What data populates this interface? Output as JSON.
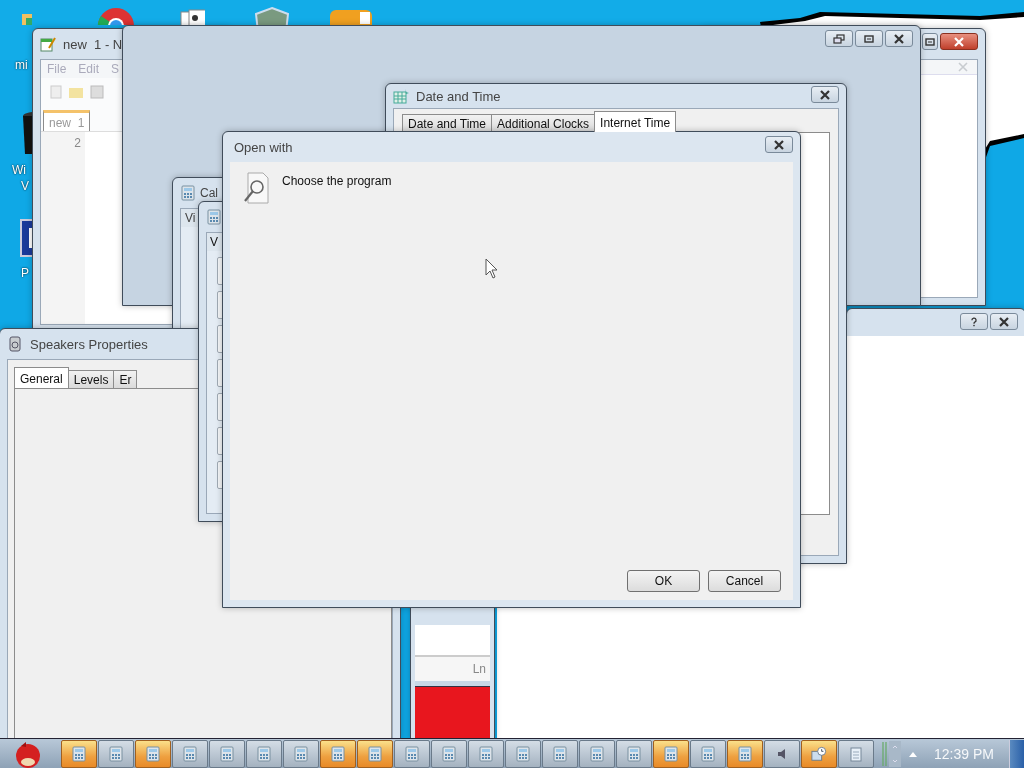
{
  "desktop_icons": [
    {
      "kind": "photo-app",
      "label_lines": [
        "mi"
      ]
    },
    {
      "kind": "round-app"
    },
    {
      "kind": "cards"
    },
    {
      "kind": "shield"
    },
    {
      "kind": "game"
    },
    {
      "kind": "trash",
      "label_lines": [
        "Wi",
        "V"
      ]
    },
    {
      "kind": "blue-square",
      "label_lines": [
        "P"
      ]
    }
  ],
  "notepad": {
    "title": "new  1 - N",
    "menu": [
      "File",
      "Edit",
      "S"
    ],
    "tabs": [
      {
        "label": "new  1",
        "selected": true
      }
    ],
    "line_numbers": [
      "2"
    ]
  },
  "date_and_time": {
    "title": "Date and Time",
    "tabs": [
      {
        "label": "Date and Time",
        "selected": false
      },
      {
        "label": "Additional Clocks",
        "selected": false
      },
      {
        "label": "Internet Time",
        "selected": true
      }
    ]
  },
  "calculators": [
    {
      "title": "Cal",
      "menu": [
        "Vi"
      ]
    },
    {
      "menu": [
        "V"
      ]
    }
  ],
  "speakers_properties": {
    "title": "Speakers Properties",
    "tabs": [
      {
        "label": "General",
        "selected": true
      },
      {
        "label": "Levels",
        "selected": false
      },
      {
        "label": "Er",
        "selected": false
      }
    ]
  },
  "status_strip": {
    "status": "Ln"
  },
  "open_with": {
    "title": "Open with",
    "heading": "Choose the program",
    "buttons": [
      "OK",
      "Cancel"
    ]
  },
  "taskbar": {
    "tasks": [
      {
        "kind": "calculator",
        "highlighted": true
      },
      {
        "kind": "calculator",
        "highlighted": false
      },
      {
        "kind": "calculator",
        "highlighted": true
      },
      {
        "kind": "calculator",
        "highlighted": false
      },
      {
        "kind": "calculator",
        "highlighted": false
      },
      {
        "kind": "calculator",
        "highlighted": false
      },
      {
        "kind": "calculator",
        "highlighted": false
      },
      {
        "kind": "calculator",
        "highlighted": true
      },
      {
        "kind": "calculator",
        "highlighted": true
      },
      {
        "kind": "calculator",
        "highlighted": false
      },
      {
        "kind": "calculator",
        "highlighted": false
      },
      {
        "kind": "calculator",
        "highlighted": false
      },
      {
        "kind": "calculator",
        "highlighted": false
      },
      {
        "kind": "calculator",
        "highlighted": false
      },
      {
        "kind": "calculator",
        "highlighted": false
      },
      {
        "kind": "calculator",
        "highlighted": false
      },
      {
        "kind": "calculator",
        "highlighted": true
      },
      {
        "kind": "calculator",
        "highlighted": false
      },
      {
        "kind": "calculator",
        "highlighted": true
      },
      {
        "kind": "speaker",
        "highlighted": false
      },
      {
        "kind": "clock",
        "highlighted": true
      },
      {
        "kind": "notepad",
        "highlighted": false
      }
    ],
    "clock": "12:39 PM"
  }
}
